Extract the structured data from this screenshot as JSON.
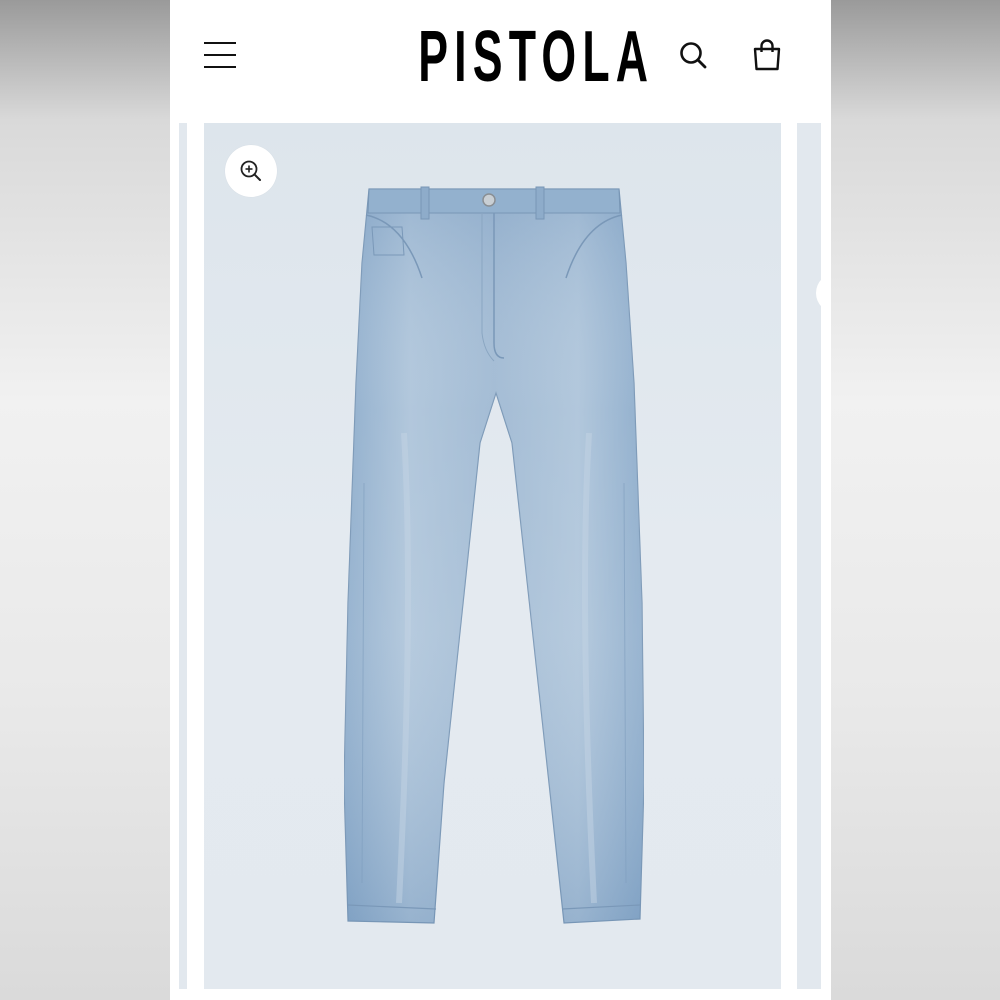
{
  "header": {
    "brand": "PISTOLA",
    "icons": {
      "menu": "hamburger-menu-icon",
      "search": "search-icon",
      "bag": "shopping-bag-icon"
    }
  },
  "gallery": {
    "zoom_icon": "zoom-in-icon",
    "product_image": "light-wash-straight-leg-jeans",
    "colors": {
      "background": "#e2e8ee",
      "denim": "#8fb0cf"
    }
  }
}
